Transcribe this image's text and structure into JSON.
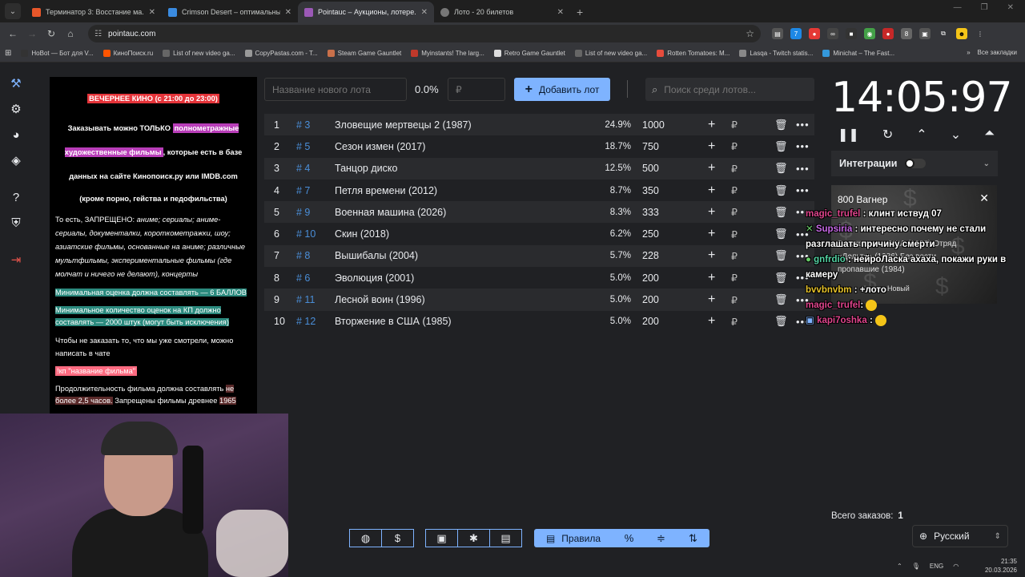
{
  "browser": {
    "tabs": [
      {
        "title": "Терминатор 3: Восстание ма...",
        "color": "#e8572a"
      },
      {
        "title": "Crimson Desert – оптимальны...",
        "color": "#3a8be0"
      },
      {
        "title": "Pointauc – Аукционы, лотере...",
        "color": "#9b59b6"
      },
      {
        "title": "Лото - 20 билетов",
        "color": "#aaaaaa"
      }
    ],
    "url": "pointauc.com",
    "bookmarks": [
      {
        "label": "HoBot — Бот для V...",
        "color": "#333"
      },
      {
        "label": "КиноПоиск.ru",
        "color": "#f50"
      },
      {
        "label": "List of new video ga...",
        "color": "#666"
      },
      {
        "label": "CopyPastas.com - T...",
        "color": "#999"
      },
      {
        "label": "Steam Game Gauntlet",
        "color": "#c9704a"
      },
      {
        "label": "Myinstants! The larg...",
        "color": "#c0392b"
      },
      {
        "label": "Retro Game Gauntlet",
        "color": "#ddd"
      },
      {
        "label": "List of new video ga...",
        "color": "#666"
      },
      {
        "label": "Rotten Tomatoes: M...",
        "color": "#e74c3c"
      },
      {
        "label": "Lasqa - Twitch statis...",
        "color": "#888"
      },
      {
        "label": "Minichat – The Fast...",
        "color": "#3498db"
      }
    ],
    "all_bookmarks": "Все закладки"
  },
  "rules_panel": {
    "title": "ВЕЧЕРНЕЕ КИНО (с 21:00 до 23:00)",
    "p1_a": "Заказывать можно ТОЛЬКО",
    "p1_b": "полнометражные художественные фильмы",
    "p1_c": ", которые есть в базе данных на сайте Кинопоиск.ру или IMDB.com",
    "p2": "(кроме порно, гейства и педофильства)",
    "p3_a": "То есть, ЗАПРЕЩЕНО:",
    "p3_b": "аниме; сериалы; аниме-сериалы, документалки, короткометражки, шоу; азиатские фильмы, основанные на аниме; различные мультфильмы, экспериментальные фильмы (где молчат и ничего не делают), концерты",
    "p4": "Минимальная оценка должна составлять — 6 БАЛЛОВ",
    "p5": "Минимальное количество оценок на КП должно составлять — 2000 штук (могут быть исключения)",
    "p6": "Чтобы не заказать то, что мы уже смотрели, можно написать в чате",
    "p7": "!кп \"название фильма\"",
    "p8_a": "Продолжительность фильма должна составлять",
    "p8_b": "не более 2,5 часов.",
    "p8_c": "Запрещены фильмы древнее",
    "p8_d": "1965"
  },
  "controls": {
    "lot_placeholder": "Название нового лота",
    "percent": "0.0%",
    "sum_placeholder": "₽",
    "add_label": "Добавить лот",
    "search_placeholder": "Поиск среди лотов..."
  },
  "lots": [
    {
      "n": "1",
      "id": "# 3",
      "name": "Зловещие мертвецы 2 (1987)",
      "pct": "24.9%",
      "amount": "1000"
    },
    {
      "n": "2",
      "id": "# 5",
      "name": "Сезон измен (2017)",
      "pct": "18.7%",
      "amount": "750"
    },
    {
      "n": "3",
      "id": "# 4",
      "name": "Танцор диско",
      "pct": "12.5%",
      "amount": "500"
    },
    {
      "n": "4",
      "id": "# 7",
      "name": "Петля времени (2012)",
      "pct": "8.7%",
      "amount": "350"
    },
    {
      "n": "5",
      "id": "# 9",
      "name": "Военная машина (2026)",
      "pct": "8.3%",
      "amount": "333"
    },
    {
      "n": "6",
      "id": "# 10",
      "name": "Скин (2018)",
      "pct": "6.2%",
      "amount": "250"
    },
    {
      "n": "7",
      "id": "# 8",
      "name": "Вышибалы (2004)",
      "pct": "5.7%",
      "amount": "228"
    },
    {
      "n": "8",
      "id": "# 6",
      "name": "Эволюция (2001)",
      "pct": "5.0%",
      "amount": "200"
    },
    {
      "n": "9",
      "id": "# 11",
      "name": "Лесной воин (1996)",
      "pct": "5.0%",
      "amount": "200"
    },
    {
      "n": "10",
      "id": "# 12",
      "name": "Вторжение в США (1985)",
      "pct": "5.0%",
      "amount": "200"
    }
  ],
  "lot_row": {
    "plus": "+",
    "rub": "₽",
    "trash": "🗑",
    "more": "•••"
  },
  "timer": {
    "value": "14:05:97"
  },
  "integrations": {
    "label": "Интеграции"
  },
  "overlay": {
    "title": "800 Вагнер",
    "line1": "Вторжение в США (1985)  Отряд",
    "line2": "«Дельта» (1986)   Без вести",
    "line3": "пропавшие (1984)",
    "line4": "Новый"
  },
  "chat": [
    {
      "user": "magic_trufel",
      "msg": ": клинт иствуд 07"
    },
    {
      "user": "Supsiria",
      "msg": ": интересно почему не стали разглашать причину смерти"
    },
    {
      "user": "gnfrdio",
      "msg": ": нейроЛаска ахаха, покажи руки в камеру"
    },
    {
      "user": "bvvbnvbm",
      "msg": ": +лото"
    },
    {
      "user": "magic_trufel",
      "msg": ":"
    },
    {
      "user": "kapi7oshka",
      "msg": ":"
    }
  ],
  "footer": {
    "total_label": "Всего заказов:",
    "total_value": "1",
    "language": "Русский",
    "rules_label": "Правила"
  },
  "tray": {
    "lang": "ENG",
    "time": "21:35",
    "date": "20.03.2026"
  }
}
